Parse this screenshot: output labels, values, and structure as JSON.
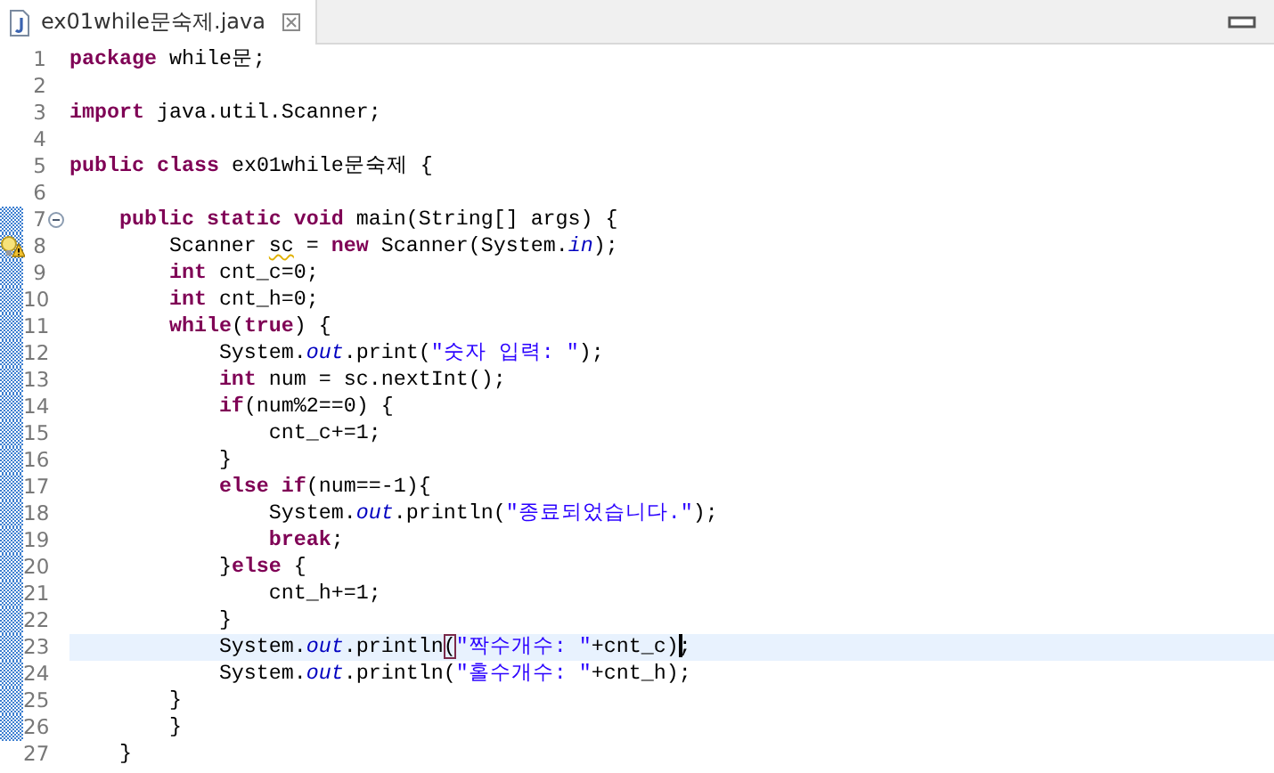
{
  "tab": {
    "title": "ex01while문숙제.java",
    "selected": true
  },
  "lines": [
    {
      "number": "1",
      "tokens": [
        {
          "kind": "keyword",
          "text": "package"
        },
        {
          "kind": "plain",
          "text": " while문;"
        }
      ]
    },
    {
      "number": "2"
    },
    {
      "number": "3",
      "tokens": [
        {
          "kind": "keyword",
          "text": "import"
        },
        {
          "kind": "plain",
          "text": " java.util.Scanner;"
        }
      ]
    },
    {
      "number": "4"
    },
    {
      "number": "5",
      "tokens": [
        {
          "kind": "keyword",
          "text": "public class"
        },
        {
          "kind": "plain",
          "text": " ex01while문숙제 {"
        }
      ]
    },
    {
      "number": "6"
    },
    {
      "number": "7",
      "changed": true,
      "fold": {
        "expanded": true
      },
      "tokens": [
        {
          "kind": "keyword",
          "text": "    public static void"
        },
        {
          "kind": "plain",
          "text": " main(String[] args) {"
        }
      ]
    },
    {
      "number": "8",
      "changed": true,
      "warning": true,
      "tokens": [
        {
          "kind": "plain",
          "text": "        Scanner "
        },
        {
          "kind": "plain",
          "text": "sc",
          "warning": true
        },
        {
          "kind": "plain",
          "text": " = "
        },
        {
          "kind": "keyword",
          "text": "new"
        },
        {
          "kind": "plain",
          "text": " Scanner(System."
        },
        {
          "kind": "field",
          "text": "in"
        },
        {
          "kind": "plain",
          "text": ");"
        }
      ]
    },
    {
      "number": "9",
      "changed": true,
      "tokens": [
        {
          "kind": "keyword",
          "text": "        int"
        },
        {
          "kind": "plain",
          "text": " cnt_c=0;"
        }
      ]
    },
    {
      "number": "10",
      "changed": true,
      "tokens": [
        {
          "kind": "keyword",
          "text": "        int"
        },
        {
          "kind": "plain",
          "text": " cnt_h=0;"
        }
      ]
    },
    {
      "number": "11",
      "changed": true,
      "tokens": [
        {
          "kind": "keyword",
          "text": "        while"
        },
        {
          "kind": "plain",
          "text": "("
        },
        {
          "kind": "keyword",
          "text": "true"
        },
        {
          "kind": "plain",
          "text": ") {"
        }
      ]
    },
    {
      "number": "12",
      "changed": true,
      "tokens": [
        {
          "kind": "plain",
          "text": "            System."
        },
        {
          "kind": "field",
          "text": "out"
        },
        {
          "kind": "plain",
          "text": ".print("
        },
        {
          "kind": "string",
          "text": "\"숫자 입력: \""
        },
        {
          "kind": "plain",
          "text": ");"
        }
      ]
    },
    {
      "number": "13",
      "changed": true,
      "tokens": [
        {
          "kind": "keyword",
          "text": "            int"
        },
        {
          "kind": "plain",
          "text": " num = sc.nextInt();"
        }
      ]
    },
    {
      "number": "14",
      "changed": true,
      "tokens": [
        {
          "kind": "keyword",
          "text": "            if"
        },
        {
          "kind": "plain",
          "text": "(num%2==0) {"
        }
      ]
    },
    {
      "number": "15",
      "changed": true,
      "tokens": [
        {
          "kind": "plain",
          "text": "                cnt_c+=1;"
        }
      ]
    },
    {
      "number": "16",
      "changed": true,
      "tokens": [
        {
          "kind": "plain",
          "text": "            }"
        }
      ]
    },
    {
      "number": "17",
      "changed": true,
      "tokens": [
        {
          "kind": "keyword",
          "text": "            else if"
        },
        {
          "kind": "plain",
          "text": "(num==-1){"
        }
      ]
    },
    {
      "number": "18",
      "changed": true,
      "tokens": [
        {
          "kind": "plain",
          "text": "                System."
        },
        {
          "kind": "field",
          "text": "out"
        },
        {
          "kind": "plain",
          "text": ".println("
        },
        {
          "kind": "string",
          "text": "\"종료되었습니다.\""
        },
        {
          "kind": "plain",
          "text": ");"
        }
      ]
    },
    {
      "number": "19",
      "changed": true,
      "tokens": [
        {
          "kind": "keyword",
          "text": "                break"
        },
        {
          "kind": "plain",
          "text": ";"
        }
      ]
    },
    {
      "number": "20",
      "changed": true,
      "tokens": [
        {
          "kind": "plain",
          "text": "            }"
        },
        {
          "kind": "keyword",
          "text": "else"
        },
        {
          "kind": "plain",
          "text": " {"
        }
      ]
    },
    {
      "number": "21",
      "changed": true,
      "tokens": [
        {
          "kind": "plain",
          "text": "                cnt_h+=1;"
        }
      ]
    },
    {
      "number": "22",
      "changed": true,
      "tokens": [
        {
          "kind": "plain",
          "text": "            }"
        }
      ]
    },
    {
      "number": "23",
      "changed": true,
      "current": true,
      "tokens": [
        {
          "kind": "plain",
          "text": "            System."
        },
        {
          "kind": "field",
          "text": "out"
        },
        {
          "kind": "plain",
          "text": ".println"
        },
        {
          "kind": "plain",
          "text": "(",
          "bracket_match": true
        },
        {
          "kind": "string",
          "text": "\"짝수개수: \""
        },
        {
          "kind": "plain",
          "text": "+cnt_c)"
        },
        {
          "kind": "caret"
        },
        {
          "kind": "plain",
          "text": ";"
        }
      ]
    },
    {
      "number": "24",
      "changed": true,
      "tokens": [
        {
          "kind": "plain",
          "text": "            System."
        },
        {
          "kind": "field",
          "text": "out"
        },
        {
          "kind": "plain",
          "text": ".println("
        },
        {
          "kind": "string",
          "text": "\"홀수개수: \""
        },
        {
          "kind": "plain",
          "text": "+cnt_h);"
        }
      ]
    },
    {
      "number": "25",
      "changed": true,
      "tokens": [
        {
          "kind": "plain",
          "text": "        }"
        }
      ]
    },
    {
      "number": "26",
      "changed": true,
      "tokens": [
        {
          "kind": "plain",
          "text": "        }"
        }
      ]
    },
    {
      "number": "27",
      "tokens": [
        {
          "kind": "plain",
          "text": "    }"
        }
      ]
    }
  ]
}
